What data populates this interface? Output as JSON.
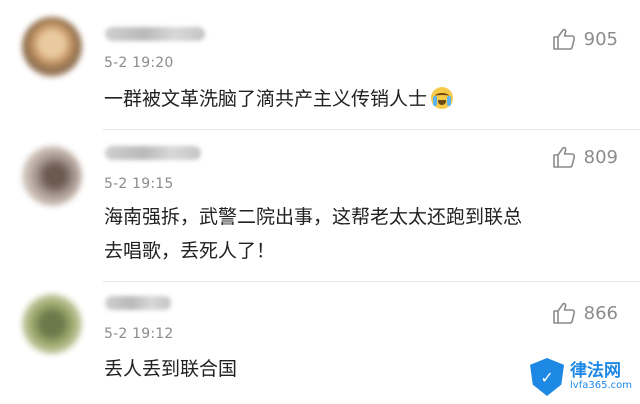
{
  "comments": [
    {
      "time": "5-2 19:20",
      "text": "一群被文革洗脑了滴共产主义传销人士",
      "emoji": "crying-emoji",
      "likes": "905"
    },
    {
      "time": "5-2 19:15",
      "line1": "海南强拆，武警二院出事，这帮老太太还跑到联总",
      "line2": "去唱歌，丢死人了！",
      "likes": "809"
    },
    {
      "time": "5-2 19:12",
      "text": "丢人丢到联合国",
      "likes": "866"
    }
  ],
  "watermark": {
    "title": "律法网",
    "sub": "lvfa365.com"
  },
  "colors": {
    "meta_gray": "#8c8c8c",
    "text": "#222222",
    "watermark_blue": "#1e88e5"
  }
}
